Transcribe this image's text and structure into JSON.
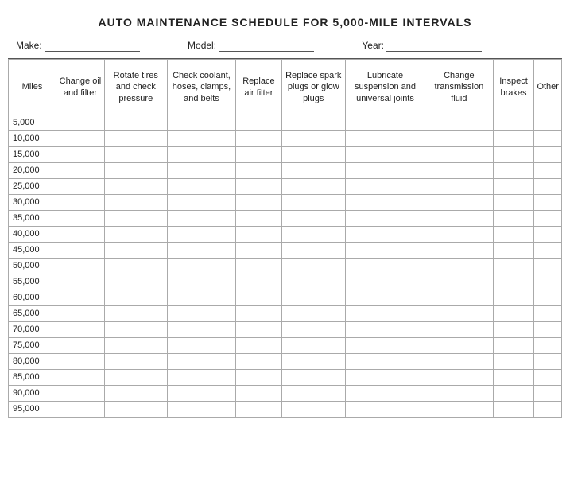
{
  "title": "AUTO MAINTENANCE SCHEDULE FOR 5,000-MILE INTERVALS",
  "info": {
    "make_label": "Make:",
    "model_label": "Model:",
    "year_label": "Year:"
  },
  "columns": [
    {
      "id": "miles",
      "label": "Miles"
    },
    {
      "id": "change_oil",
      "label": "Change oil and filter"
    },
    {
      "id": "rotate_tires",
      "label": "Rotate tires and check pressure"
    },
    {
      "id": "check_coolant",
      "label": "Check coolant, hoses, clamps, and belts"
    },
    {
      "id": "replace_air",
      "label": "Replace air filter"
    },
    {
      "id": "replace_spark",
      "label": "Replace spark plugs or glow plugs"
    },
    {
      "id": "lubricate",
      "label": "Lubricate suspension and universal joints"
    },
    {
      "id": "change_trans",
      "label": "Change transmission fluid"
    },
    {
      "id": "inspect_brakes",
      "label": "Inspect brakes"
    },
    {
      "id": "other",
      "label": "Other"
    }
  ],
  "rows": [
    "5,000",
    "10,000",
    "15,000",
    "20,000",
    "25,000",
    "30,000",
    "35,000",
    "40,000",
    "45,000",
    "50,000",
    "55,000",
    "60,000",
    "65,000",
    "70,000",
    "75,000",
    "80,000",
    "85,000",
    "90,000",
    "95,000"
  ]
}
